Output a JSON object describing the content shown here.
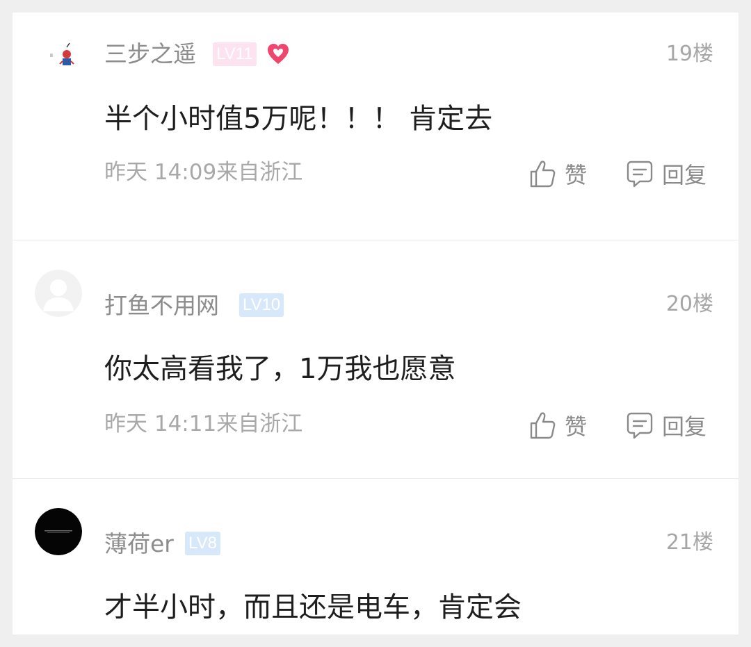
{
  "comments": [
    {
      "username": "三步之遥",
      "level": "LV11",
      "floor": "19楼",
      "content": "半个小时值5万呢！！！ 肯定去",
      "meta": "昨天 14:09来自浙江",
      "like_label": "赞",
      "reply_label": "回复"
    },
    {
      "username": "打鱼不用网",
      "level": "LV10",
      "floor": "20楼",
      "content": "你太高看我了，1万我也愿意",
      "meta": "昨天 14:11来自浙江",
      "like_label": "赞",
      "reply_label": "回复"
    },
    {
      "username": "薄荷er",
      "level": "LV8",
      "floor": "21楼",
      "content": "才半小时，而且还是电车，肯定会"
    }
  ],
  "colors": {
    "badge_pink": "#fde2ef",
    "badge_blue": "#d8e8fb",
    "heart": "#f0466e"
  }
}
